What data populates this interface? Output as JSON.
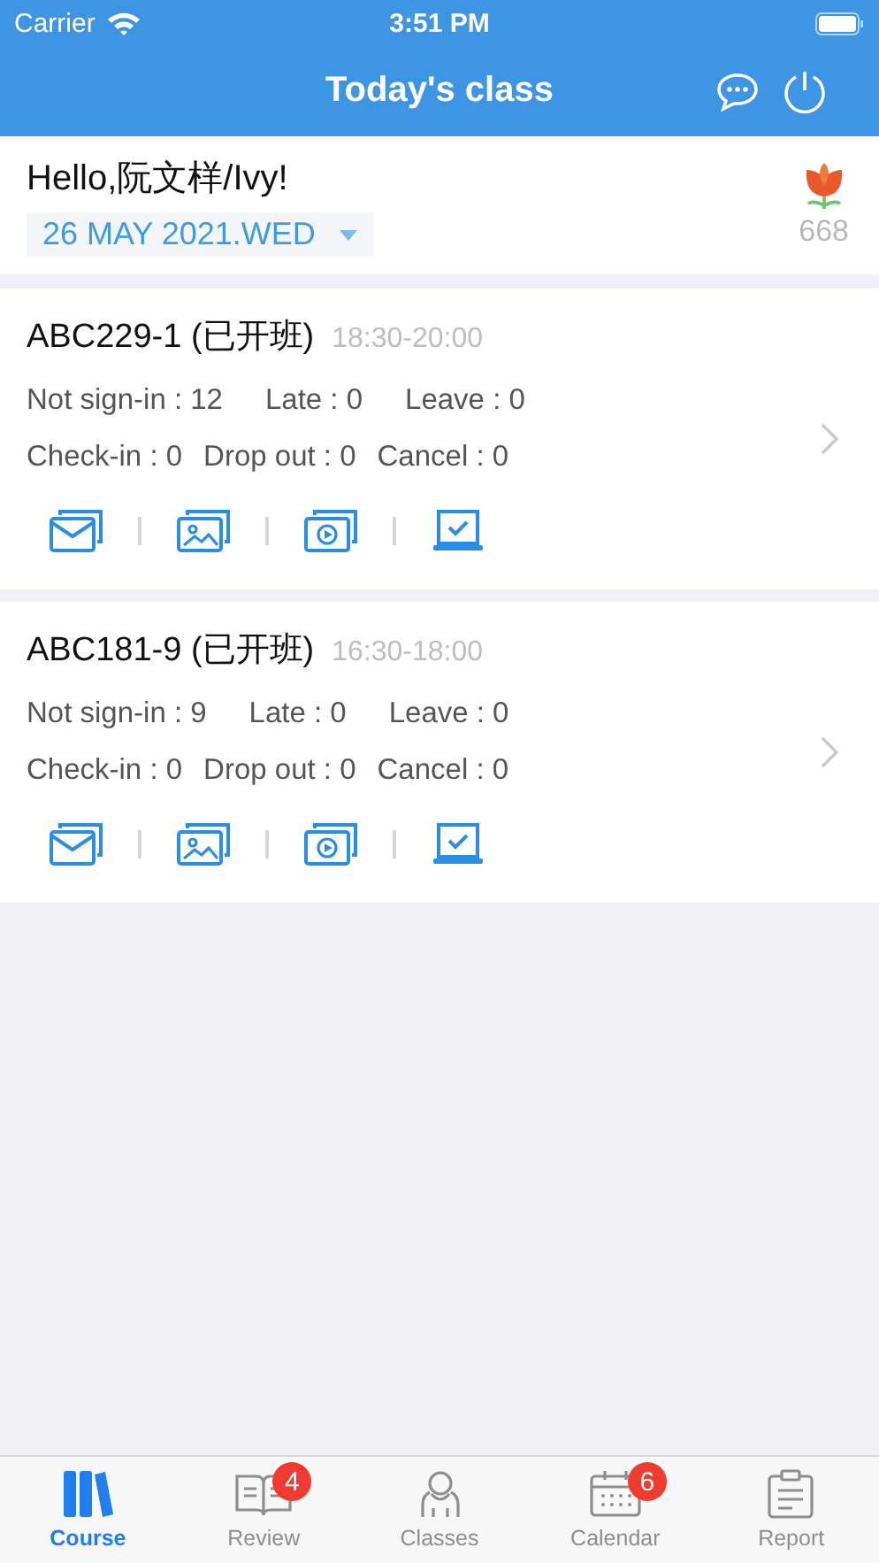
{
  "status_bar": {
    "carrier": "Carrier",
    "time": "3:51 PM"
  },
  "nav": {
    "title": "Today's class"
  },
  "greeting": {
    "text": "Hello,阮文样/Ivy!",
    "date": "26 MAY 2021.WED",
    "points": "668"
  },
  "classes": [
    {
      "name": "ABC229-1 (已开班)",
      "time": "18:30-20:00",
      "stats_row_1": [
        "Not sign-in : 12",
        "Late : 0",
        "Leave : 0"
      ],
      "stats_row_2": [
        "Check-in : 0",
        "Drop out : 0",
        "Cancel : 0"
      ]
    },
    {
      "name": "ABC181-9 (已开班)",
      "time": "16:30-18:00",
      "stats_row_1": [
        "Not sign-in : 9",
        "Late : 0",
        "Leave : 0"
      ],
      "stats_row_2": [
        "Check-in : 0",
        "Drop out : 0",
        "Cancel : 0"
      ]
    }
  ],
  "tabs": [
    {
      "kind": "course",
      "label": "Course",
      "selected": true
    },
    {
      "kind": "review",
      "label": "Review",
      "selected": false,
      "badge": "4"
    },
    {
      "kind": "classes",
      "label": "Classes",
      "selected": false
    },
    {
      "kind": "calendar",
      "label": "Calendar",
      "selected": false,
      "badge": "6"
    },
    {
      "kind": "report",
      "label": "Report",
      "selected": false
    }
  ]
}
